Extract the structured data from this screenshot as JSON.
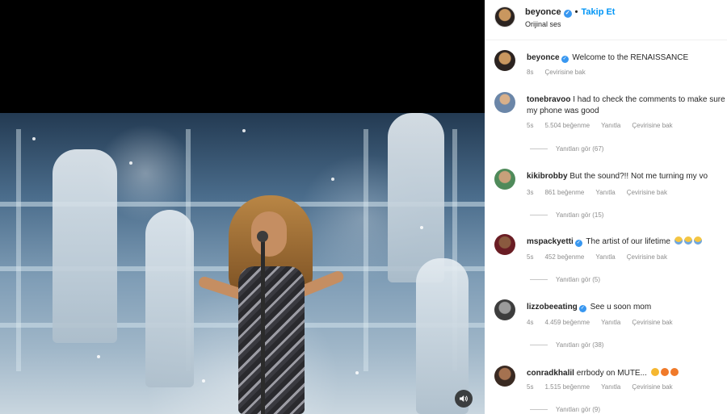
{
  "post": {
    "username": "beyonce",
    "follow_label": "Takip Et",
    "audio_label": "Orijinal ses"
  },
  "comments": [
    {
      "username": "beyonce",
      "verified": true,
      "text": "Welcome to the RENAISSANCE",
      "time": "8s",
      "likes": "",
      "reply": "",
      "translate": "Çevirisine bak",
      "replies": ""
    },
    {
      "username": "tonebravoo",
      "verified": false,
      "text": "I had to check the comments to make sure my phone was good",
      "time": "5s",
      "likes": "5.504 beğenme",
      "reply": "Yanıtla",
      "translate": "Çevirisine bak",
      "replies": "Yanıtları gör (67)"
    },
    {
      "username": "kikibrobby",
      "verified": false,
      "text": "But the sound?!! Not me turning my vo",
      "time": "3s",
      "likes": "861 beğenme",
      "reply": "Yanıtla",
      "translate": "Çevirisine bak",
      "replies": "Yanıtları gör (15)"
    },
    {
      "username": "mspackyetti",
      "verified": true,
      "text": "The artist of our lifetime",
      "time": "5s",
      "likes": "452 beğenme",
      "reply": "Yanıtla",
      "translate": "Çevirisine bak",
      "replies": "Yanıtları gör (5)"
    },
    {
      "username": "lizzobeeating",
      "verified": true,
      "text": "See u soon mom",
      "time": "4s",
      "likes": "4.459 beğenme",
      "reply": "Yanıtla",
      "translate": "Çevirisine bak",
      "replies": "Yanıtları gör (38)"
    },
    {
      "username": "conradkhalil",
      "verified": false,
      "text": "errbody on MUTE...",
      "time": "5s",
      "likes": "1.515 beğenme",
      "reply": "Yanıtla",
      "translate": "Çevirisine bak",
      "replies": "Yanıtları gör (9)"
    }
  ],
  "icons": {
    "audio": "speaker-icon",
    "verified": "verified-badge-icon",
    "emoji_mspackyetti": "crying-face-emoji",
    "emoji_conradkhalil": "fire-emoji"
  },
  "colors": {
    "accent": "#0095f6",
    "verified": "#3897f0",
    "muted_text": "#8e8e8e"
  }
}
